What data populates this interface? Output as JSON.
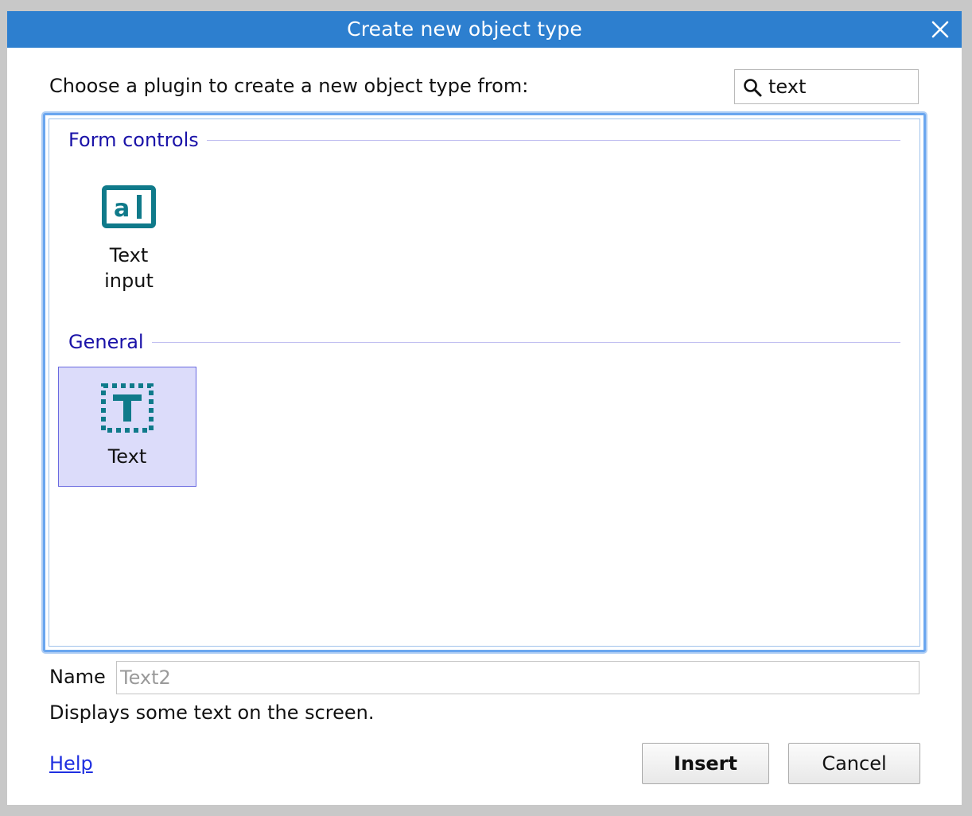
{
  "window": {
    "title": "Create new object type",
    "close_icon": "close-icon"
  },
  "prompt": "Choose a plugin to create a new object type from:",
  "search": {
    "icon": "search-icon",
    "value": "text",
    "placeholder": ""
  },
  "groups": [
    {
      "label": "Form controls",
      "items": [
        {
          "label": "Text\ninput",
          "icon": "text-input-icon",
          "selected": false
        }
      ]
    },
    {
      "label": "General",
      "items": [
        {
          "label": "Text",
          "icon": "text-object-icon",
          "selected": true
        }
      ]
    }
  ],
  "name_field": {
    "label": "Name",
    "placeholder": "Text2",
    "value": ""
  },
  "description": "Displays some text on the screen.",
  "help_link": "Help",
  "buttons": {
    "insert": "Insert",
    "cancel": "Cancel"
  },
  "colors": {
    "titlebar": "#2d7fcf",
    "group_label": "#1a12a8",
    "icon_teal": "#0f7a8a",
    "selected_bg": "#dcdcfa",
    "focus_border": "#6aa6ef",
    "link": "#1f2fe0"
  }
}
